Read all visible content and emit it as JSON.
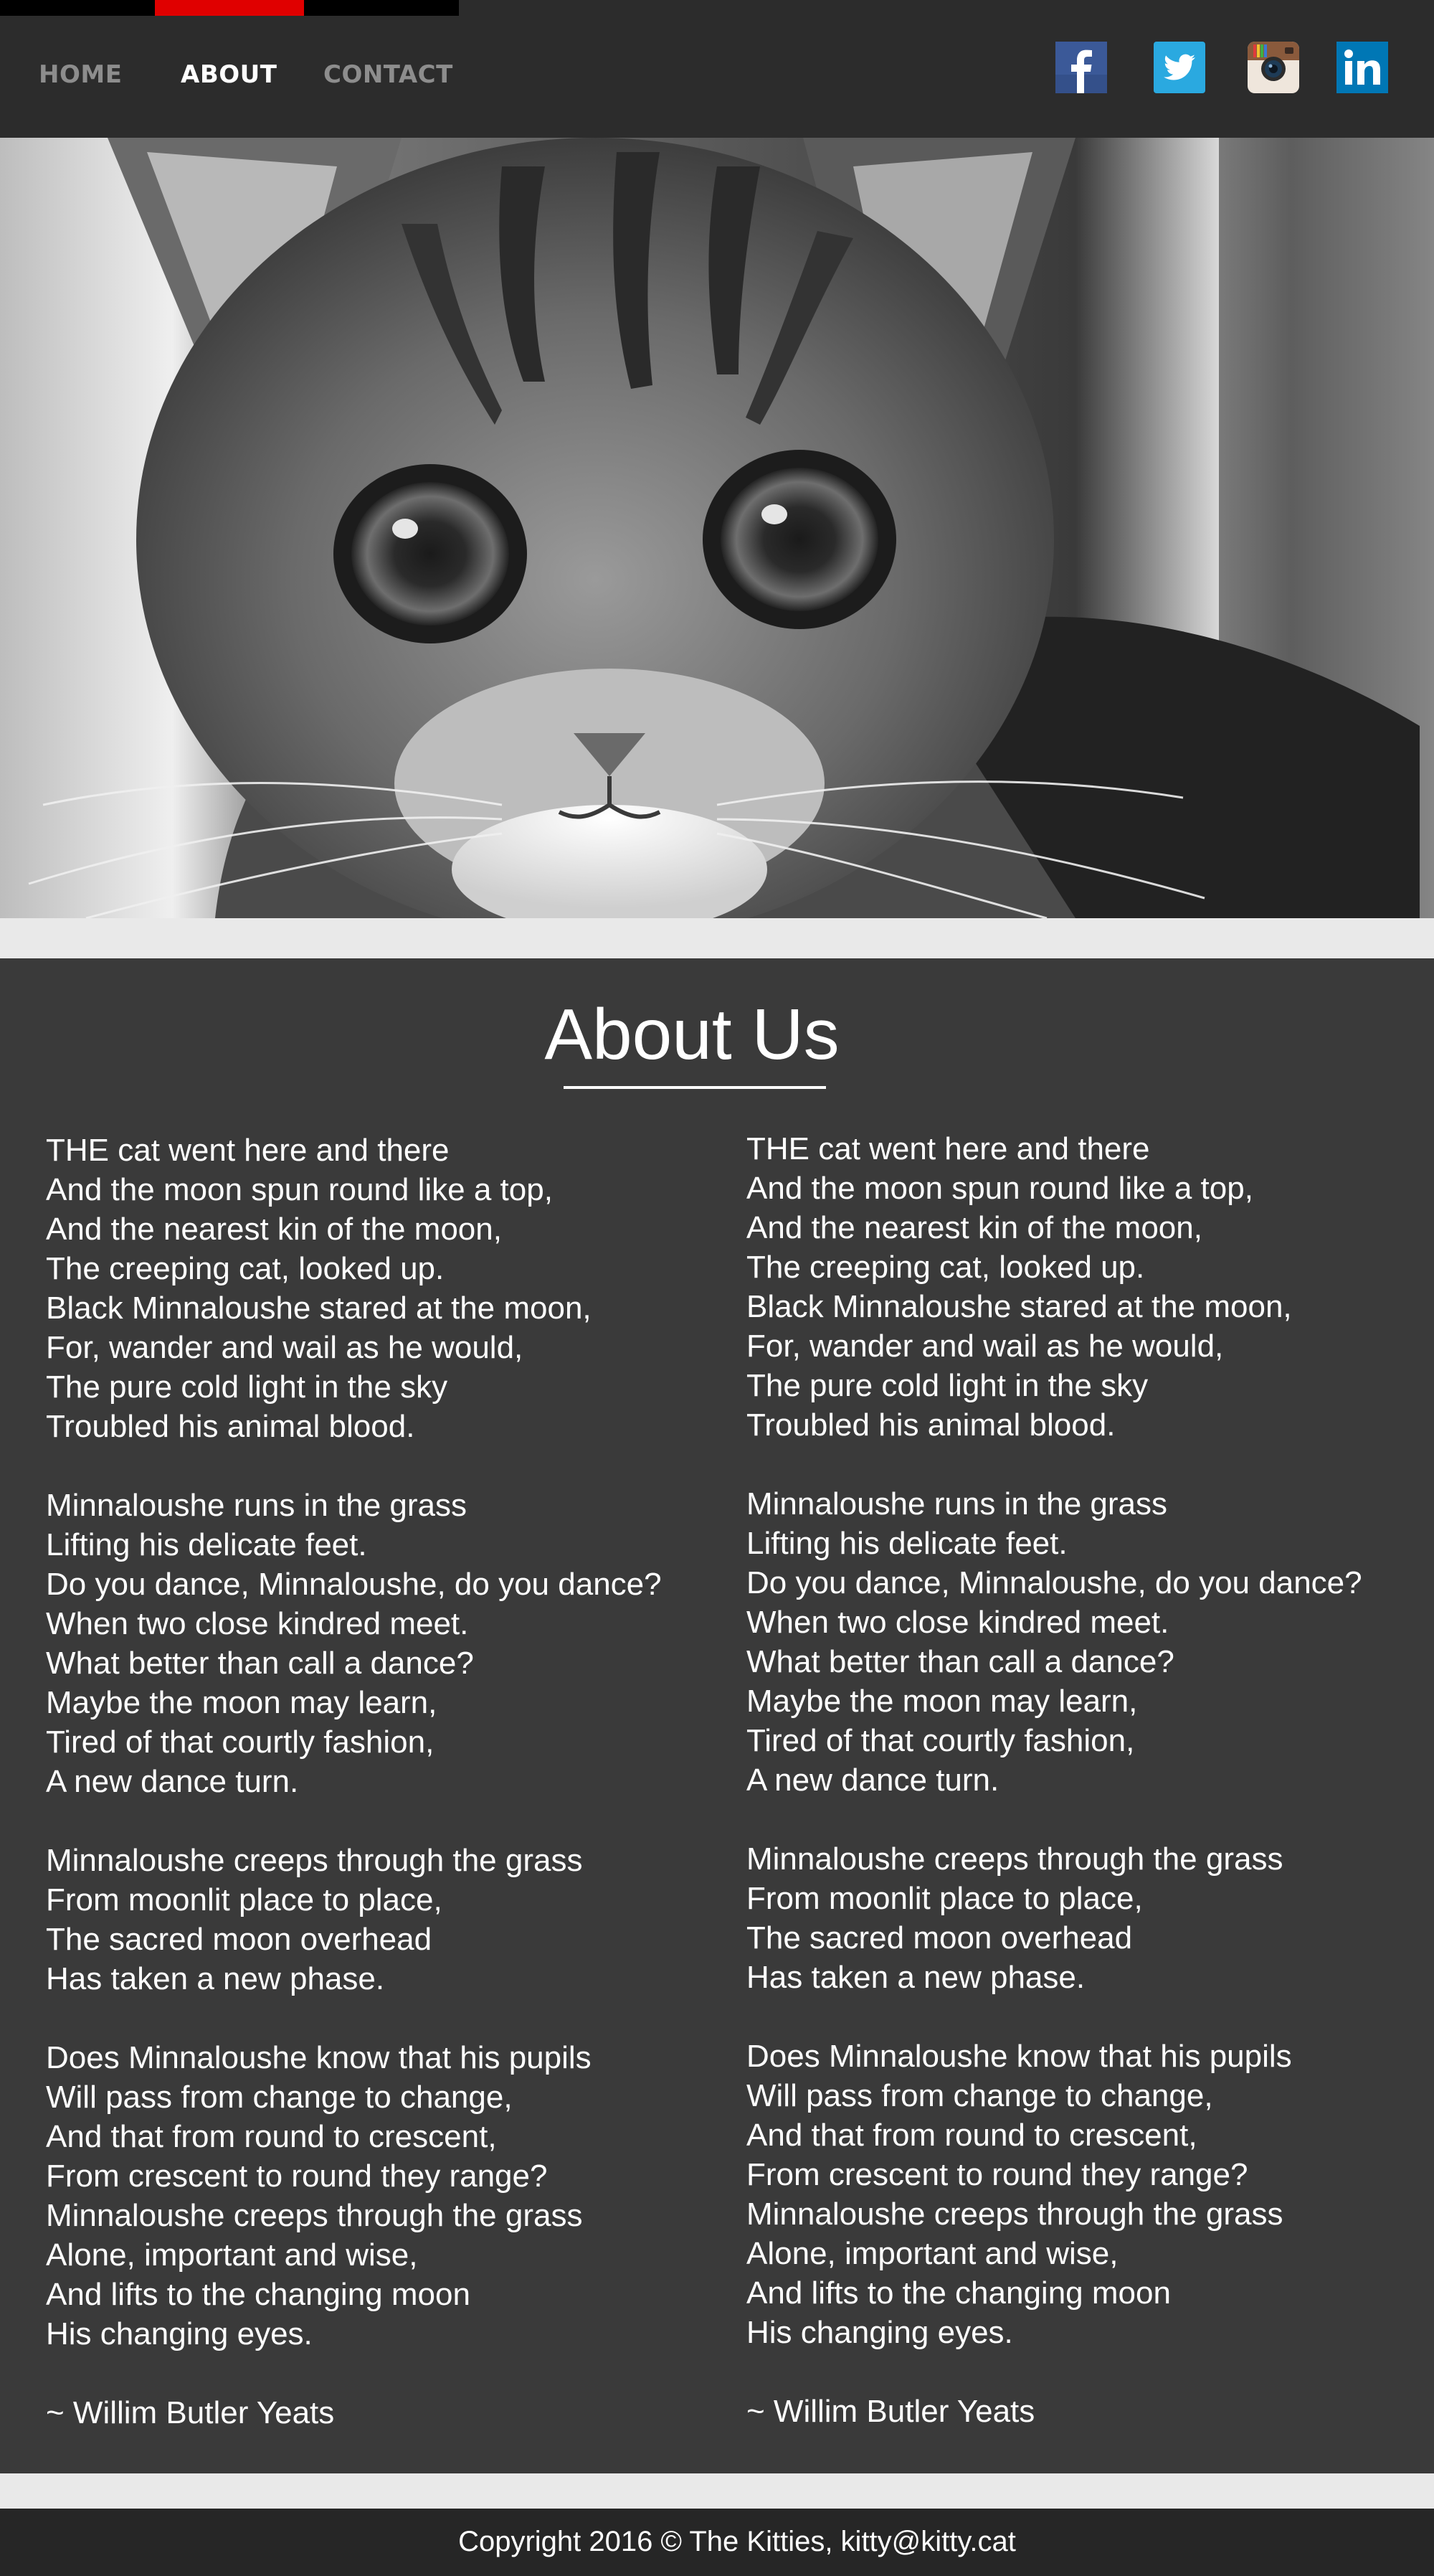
{
  "nav": {
    "items": [
      {
        "label": "HOME"
      },
      {
        "label": "ABOUT"
      },
      {
        "label": "CONTACT"
      }
    ]
  },
  "social": {
    "icons": [
      "facebook-icon",
      "twitter-icon",
      "instagram-icon",
      "linkedin-icon"
    ],
    "colors": {
      "facebook": "#3b5998",
      "twitter": "#2aa9e0",
      "linkedin": "#0077b5"
    }
  },
  "hero": {
    "image": "black-and-white tabby kitten"
  },
  "about": {
    "title": "About Us",
    "stanzas": [
      [
        "THE cat went here and there",
        "And the moon spun round like a top,",
        "And the nearest kin of the moon,",
        "The creeping cat, looked up.",
        "Black Minnaloushe stared at the moon,",
        "For, wander and wail as he would,",
        "The pure cold light in the sky",
        "Troubled his animal blood."
      ],
      [
        "Minnaloushe runs in the grass",
        "Lifting his delicate feet.",
        "Do you dance, Minnaloushe, do you dance?",
        "When two close kindred meet.",
        "What better than call a dance?",
        "Maybe the moon may learn,",
        "Tired of that courtly fashion,",
        "A new dance turn."
      ],
      [
        "Minnaloushe creeps through the grass",
        "From moonlit place to place,",
        "The sacred moon overhead",
        "Has taken a new phase."
      ],
      [
        "Does Minnaloushe know that his pupils",
        "Will pass from change to change,",
        "And that from round to crescent,",
        "From crescent to round they range?",
        "Minnaloushe creeps through the grass",
        "Alone, important and wise,",
        "And lifts to the changing moon",
        "His changing eyes."
      ]
    ],
    "signature": "~ Willim Butler Yeats"
  },
  "footer": {
    "text": "Copyright 2016 © The Kitties, kitty@kitty.cat"
  },
  "colors": {
    "header_bg": "#2c2c2c",
    "accent": "#e00000",
    "main_bg": "#3a3a3a",
    "footer_bg": "#262626"
  }
}
